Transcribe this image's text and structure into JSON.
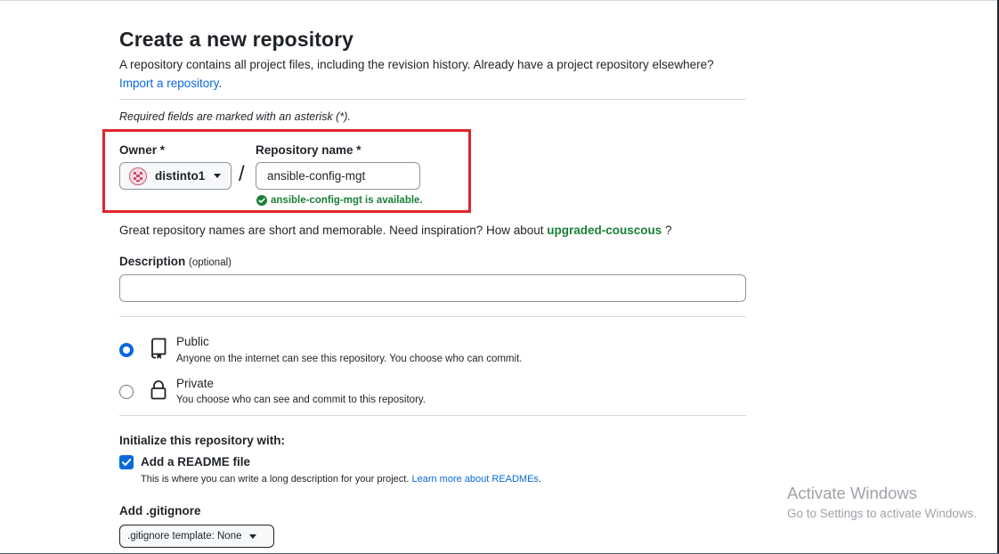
{
  "page": {
    "title": "Create a new repository",
    "subtitle": "A repository contains all project files, including the revision history. Already have a project repository elsewhere?",
    "import_link": "Import a repository",
    "import_link_suffix": ".",
    "required_note": "Required fields are marked with an asterisk (*)."
  },
  "owner": {
    "label": "Owner *",
    "value": "distinto1",
    "avatar_icon": "identicon-avatar"
  },
  "separator": "/",
  "repo_name": {
    "label": "Repository name *",
    "value": "ansible-config-mgt",
    "availability": "ansible-config-mgt is available.",
    "availability_color": "#1a7f37"
  },
  "inspiration": {
    "text": "Great repository names are short and memorable. Need inspiration? How about",
    "suggestion": "upgraded-couscous",
    "suffix": "?"
  },
  "description": {
    "label": "Description",
    "optional": "(optional)",
    "value": ""
  },
  "visibility": {
    "options": [
      {
        "title": "Public",
        "desc": "Anyone on the internet can see this repository. You choose who can commit.",
        "selected": true,
        "icon": "repo-icon"
      },
      {
        "title": "Private",
        "desc": "You choose who can see and commit to this repository.",
        "selected": false,
        "icon": "lock-icon"
      }
    ]
  },
  "initialize": {
    "label": "Initialize this repository with:",
    "readme": {
      "title": "Add a README file",
      "checked": true,
      "desc": "This is where you can write a long description for your project.",
      "link": "Learn more about READMEs",
      "link_suffix": "."
    }
  },
  "gitignore": {
    "label": "Add .gitignore",
    "button": ".gitignore template: None"
  },
  "watermark": {
    "title": "Activate Windows",
    "subtitle": "Go to Settings to activate Windows."
  },
  "colors": {
    "accent": "#0969da",
    "highlight_box": "#e0242a",
    "success": "#1a7f37"
  }
}
